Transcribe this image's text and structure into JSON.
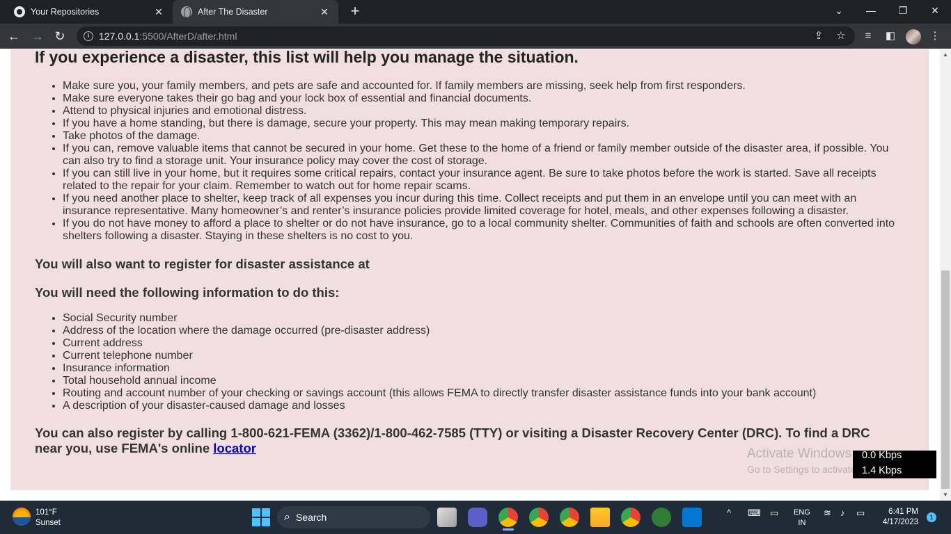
{
  "browser": {
    "tabs": [
      {
        "title": "Your Repositories",
        "active": false,
        "favicon": "github-icon"
      },
      {
        "title": "After The Disaster",
        "active": true,
        "favicon": "globe-icon"
      }
    ],
    "close_glyph": "✕",
    "new_tab_glyph": "+",
    "url_host": "127.0.0.1",
    "url_rest": ":5500/AfterD/after.html",
    "window_controls": {
      "dropdown": "⌄",
      "minimize": "—",
      "restore": "❐",
      "close": "✕"
    }
  },
  "page": {
    "heading": "If you experience a disaster, this list will help you manage the situation.",
    "checklist": [
      "Make sure you, your family members, and pets are safe and accounted for. If family members are missing, seek help from first responders.",
      "Make sure everyone takes their go bag and your lock box of essential and financial documents.",
      "Attend to physical injuries and emotional distress.",
      "If you have a home standing, but there is damage, secure your property. This may mean making temporary repairs.",
      "Take photos of the damage.",
      "If you can, remove valuable items that cannot be secured in your home. Get these to the home of a friend or family member outside of the disaster area, if possible. You can also try to find a storage unit. Your insurance policy may cover the cost of storage.",
      "If you can still live in your home, but it requires some critical repairs, contact your insurance agent. Be sure to take photos before the work is started. Save all receipts related to the repair for your claim. Remember to watch out for home repair scams.",
      "If you need another place to shelter, keep track of all expenses you incur during this time. Collect receipts and put them in an envelope until you can meet with an insurance representative. Many homeowner’s and renter’s insurance policies provide limited coverage for hotel, meals, and other expenses following a disaster.",
      "If you do not have money to afford a place to shelter or do not have insurance, go to a local community shelter. Communities of faith and schools are often converted into shelters following a disaster. Staying in these shelters is no cost to you."
    ],
    "register_heading": "You will also want to register for disaster assistance at",
    "info_heading": "You will need the following information to do this:",
    "info_list": [
      "Social Security number",
      "Address of the location where the damage occurred (pre-disaster address)",
      "Current address",
      "Current telephone number",
      "Insurance information",
      "Total household annual income",
      "Routing and account number of your checking or savings account (this allows FEMA to directly transfer disaster assistance funds into your bank account)",
      "A description of your disaster-caused damage and losses"
    ],
    "final_text": "You can also register by calling 1-800-621-FEMA (3362)/1-800-462-7585 (TTY) or visiting a Disaster Recovery Center (DRC). To find a DRC near you, use FEMA's online ",
    "final_link": "locator"
  },
  "watermark": {
    "line1": "Activate Windows",
    "line2": "Go to Settings to activate Windows."
  },
  "net_meter": {
    "download": "0.0 Kbps",
    "upload": "1.4 Kbps"
  },
  "taskbar": {
    "weather_temp": "101°F",
    "weather_desc": "Sunset",
    "search_label": "Search",
    "lang_line1": "ENG",
    "lang_line2": "IN",
    "time": "6:41 PM",
    "date": "4/17/2023",
    "notification_count": "1"
  },
  "colors": {
    "page_background": "#f1dfe0",
    "link": "#0000ee",
    "tabstrip": "#202124",
    "toolbar": "#35363a",
    "taskbar": "#202b38"
  }
}
